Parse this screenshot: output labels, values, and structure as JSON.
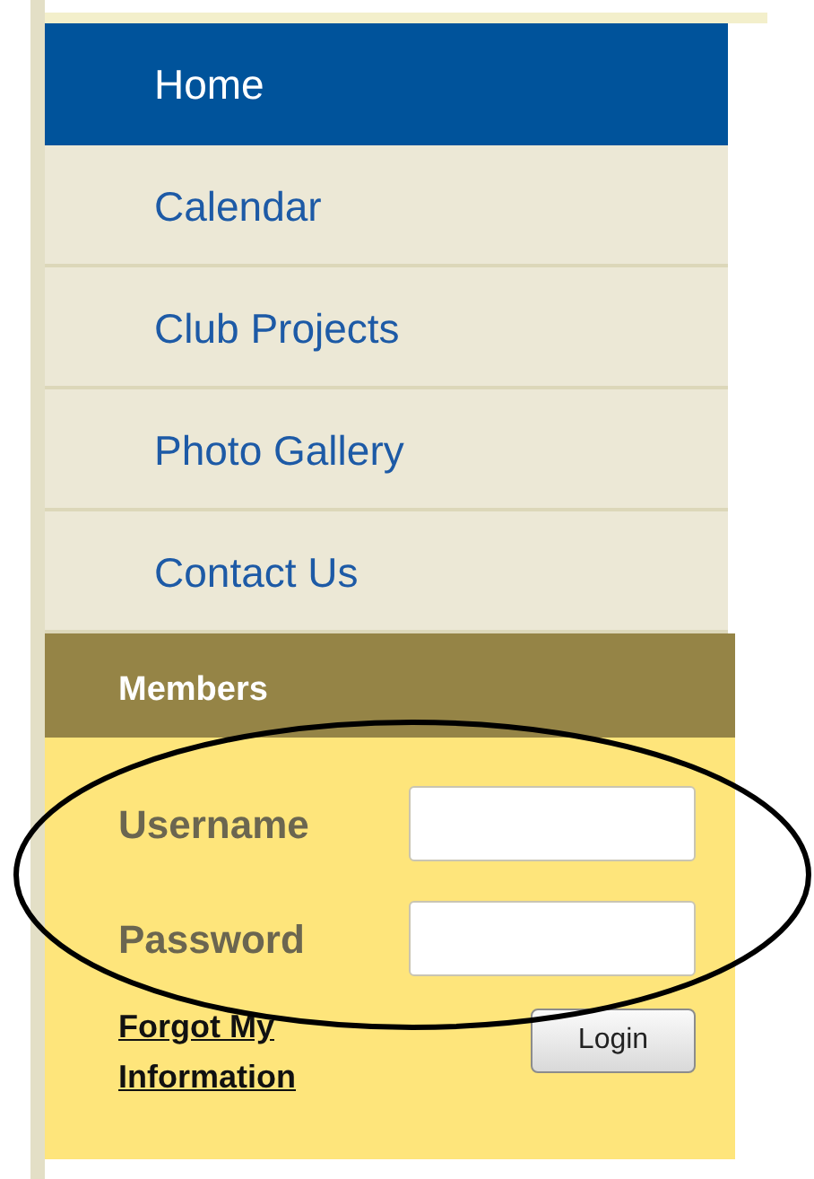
{
  "nav": [
    {
      "label": "Home",
      "selected": true
    },
    {
      "label": "Calendar",
      "selected": false
    },
    {
      "label": "Club Projects",
      "selected": false
    },
    {
      "label": "Photo Gallery",
      "selected": false
    },
    {
      "label": "Contact Us",
      "selected": false
    }
  ],
  "members": {
    "title": "Members",
    "fields": [
      {
        "label": "Username"
      },
      {
        "label": "Password"
      }
    ],
    "forgot_link": "Forgot My Information",
    "login_button": "Login"
  },
  "annotations": [
    {
      "kind": "ellipse"
    }
  ]
}
